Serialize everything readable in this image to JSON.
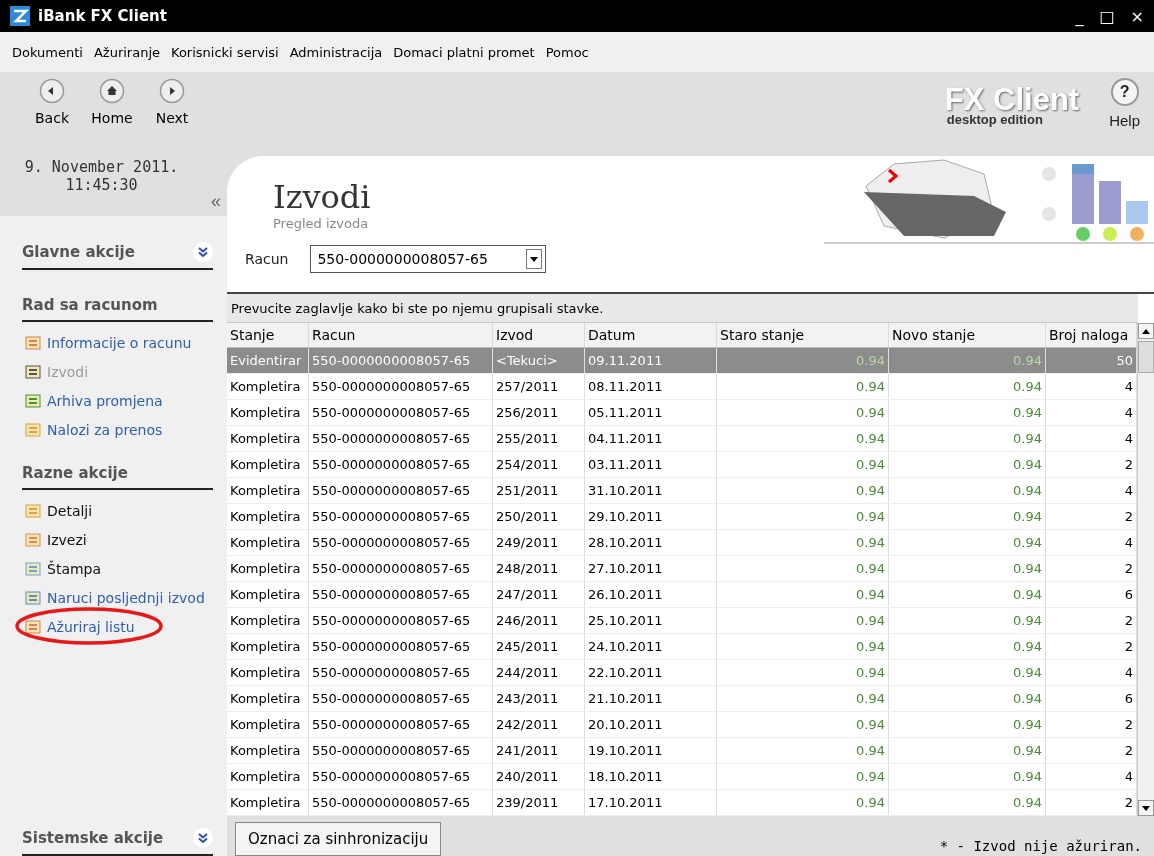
{
  "window": {
    "title": "iBank FX Client",
    "controls": [
      "_",
      "□",
      "×"
    ]
  },
  "menu": [
    "Dokumenti",
    "Ažuriranje",
    "Korisnicki servisi",
    "Administracija",
    "Domaci platni promet",
    "Pomoc"
  ],
  "toolbar": [
    {
      "label": "Back",
      "kind": "back"
    },
    {
      "label": "Home",
      "kind": "home"
    },
    {
      "label": "Next",
      "kind": "next"
    }
  ],
  "brand": {
    "name": "FX Client",
    "edition": "desktop edition"
  },
  "help": {
    "label": "Help",
    "icon": "?"
  },
  "clock": {
    "date": "9. November 2011.",
    "time": "11:45:30",
    "collapse": "«"
  },
  "sidebar": {
    "sections": [
      {
        "title": "Glavne akcije",
        "expander": true
      },
      {
        "title": "Rad sa racunom",
        "expander": false,
        "items": [
          {
            "label": "Informacije o racunu",
            "kind": "link",
            "disabled": false,
            "highlighted": false
          },
          {
            "label": "Izvodi",
            "kind": "link",
            "disabled": true,
            "highlighted": false
          },
          {
            "label": "Arhiva promjena",
            "kind": "link",
            "disabled": false,
            "highlighted": false
          },
          {
            "label": "Nalozi za prenos",
            "kind": "link",
            "disabled": false,
            "highlighted": false
          }
        ]
      },
      {
        "title": "Razne akcije",
        "expander": false,
        "items": [
          {
            "label": "Detalji",
            "kind": "action",
            "disabled": false,
            "highlighted": false
          },
          {
            "label": "Izvezi",
            "kind": "action",
            "disabled": false,
            "highlighted": false
          },
          {
            "label": "Štampa",
            "kind": "action",
            "disabled": false,
            "highlighted": false
          },
          {
            "label": "Naruci posljednji izvod",
            "kind": "link",
            "disabled": false,
            "highlighted": false
          },
          {
            "label": "Ažuriraj listu",
            "kind": "link",
            "disabled": false,
            "highlighted": true
          }
        ]
      }
    ],
    "footer": {
      "title": "Sistemske akcije",
      "expander": true
    }
  },
  "page": {
    "title": "Izvodi",
    "subtitle": "Pregled izvoda",
    "account_label": "Racun",
    "account_value": "550-0000000008057-65"
  },
  "table": {
    "group_hint": "Prevucite zaglavlje kako bi ste po njemu grupisali stavke.",
    "columns": [
      "Stanje",
      "Racun",
      "Izvod",
      "Datum",
      "Staro stanje",
      "Novo stanje",
      "Broj naloga"
    ],
    "rows": [
      {
        "cells": [
          "Evidentirar",
          "550-0000000008057-65",
          "<Tekuci>",
          "09.11.2011",
          "0.94",
          "0.94",
          "50"
        ],
        "selected": true
      },
      {
        "cells": [
          "Kompletira",
          "550-0000000008057-65",
          "257/2011",
          "08.11.2011",
          "0.94",
          "0.94",
          "4"
        ],
        "selected": false
      },
      {
        "cells": [
          "Kompletira",
          "550-0000000008057-65",
          "256/2011",
          "05.11.2011",
          "0.94",
          "0.94",
          "4"
        ],
        "selected": false
      },
      {
        "cells": [
          "Kompletira",
          "550-0000000008057-65",
          "255/2011",
          "04.11.2011",
          "0.94",
          "0.94",
          "4"
        ],
        "selected": false
      },
      {
        "cells": [
          "Kompletira",
          "550-0000000008057-65",
          "254/2011",
          "03.11.2011",
          "0.94",
          "0.94",
          "2"
        ],
        "selected": false
      },
      {
        "cells": [
          "Kompletira",
          "550-0000000008057-65",
          "251/2011",
          "31.10.2011",
          "0.94",
          "0.94",
          "4"
        ],
        "selected": false
      },
      {
        "cells": [
          "Kompletira",
          "550-0000000008057-65",
          "250/2011",
          "29.10.2011",
          "0.94",
          "0.94",
          "2"
        ],
        "selected": false
      },
      {
        "cells": [
          "Kompletira",
          "550-0000000008057-65",
          "249/2011",
          "28.10.2011",
          "0.94",
          "0.94",
          "4"
        ],
        "selected": false
      },
      {
        "cells": [
          "Kompletira",
          "550-0000000008057-65",
          "248/2011",
          "27.10.2011",
          "0.94",
          "0.94",
          "2"
        ],
        "selected": false
      },
      {
        "cells": [
          "Kompletira",
          "550-0000000008057-65",
          "247/2011",
          "26.10.2011",
          "0.94",
          "0.94",
          "6"
        ],
        "selected": false
      },
      {
        "cells": [
          "Kompletira",
          "550-0000000008057-65",
          "246/2011",
          "25.10.2011",
          "0.94",
          "0.94",
          "2"
        ],
        "selected": false
      },
      {
        "cells": [
          "Kompletira",
          "550-0000000008057-65",
          "245/2011",
          "24.10.2011",
          "0.94",
          "0.94",
          "2"
        ],
        "selected": false
      },
      {
        "cells": [
          "Kompletira",
          "550-0000000008057-65",
          "244/2011",
          "22.10.2011",
          "0.94",
          "0.94",
          "4"
        ],
        "selected": false
      },
      {
        "cells": [
          "Kompletira",
          "550-0000000008057-65",
          "243/2011",
          "21.10.2011",
          "0.94",
          "0.94",
          "6"
        ],
        "selected": false
      },
      {
        "cells": [
          "Kompletira",
          "550-0000000008057-65",
          "242/2011",
          "20.10.2011",
          "0.94",
          "0.94",
          "2"
        ],
        "selected": false
      },
      {
        "cells": [
          "Kompletira",
          "550-0000000008057-65",
          "241/2011",
          "19.10.2011",
          "0.94",
          "0.94",
          "2"
        ],
        "selected": false
      },
      {
        "cells": [
          "Kompletira",
          "550-0000000008057-65",
          "240/2011",
          "18.10.2011",
          "0.94",
          "0.94",
          "4"
        ],
        "selected": false
      },
      {
        "cells": [
          "Kompletira",
          "550-0000000008057-65",
          "239/2011",
          "17.10.2011",
          "0.94",
          "0.94",
          "2"
        ],
        "selected": false
      }
    ]
  },
  "footer": {
    "button": "Oznaci za sinhronizaciju",
    "note": "* - Izvod nije ažuriran."
  }
}
